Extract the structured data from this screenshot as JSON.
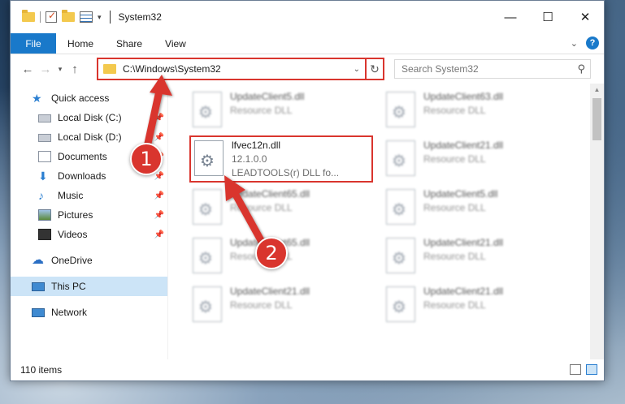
{
  "window": {
    "title": "System32"
  },
  "ribbon": {
    "tabs": [
      "File",
      "Home",
      "Share",
      "View"
    ]
  },
  "address": {
    "path": "C:\\Windows\\System32"
  },
  "search": {
    "placeholder": "Search System32"
  },
  "sidebar": {
    "items": [
      {
        "label": "Quick access",
        "icon": "star-icon",
        "pinned": false
      },
      {
        "label": "Local Disk (C:)",
        "icon": "drive-icon",
        "pinned": true
      },
      {
        "label": "Local Disk (D:)",
        "icon": "drive-icon",
        "pinned": true
      },
      {
        "label": "Documents",
        "icon": "documents-icon",
        "pinned": true
      },
      {
        "label": "Downloads",
        "icon": "download-icon",
        "pinned": true
      },
      {
        "label": "Music",
        "icon": "music-icon",
        "pinned": true
      },
      {
        "label": "Pictures",
        "icon": "pictures-icon",
        "pinned": true
      },
      {
        "label": "Videos",
        "icon": "videos-icon",
        "pinned": true
      },
      {
        "label": "OneDrive",
        "icon": "cloud-icon"
      },
      {
        "label": "This PC",
        "icon": "pc-icon",
        "selected": true
      },
      {
        "label": "Network",
        "icon": "network-icon"
      }
    ]
  },
  "files": {
    "left": [
      {
        "name": "UpdateClient5.dll",
        "type": "Resource DLL"
      },
      {
        "name": "lfvec12n.dll",
        "version": "12.1.0.0",
        "desc": "LEADTOOLS(r) DLL fo..."
      },
      {
        "name": "UpdateClient65.dll",
        "type": "Resource DLL"
      },
      {
        "name": "UpdateClient65.dll",
        "type": "Resource DLL"
      },
      {
        "name": "UpdateClient21.dll",
        "type": "Resource DLL"
      }
    ],
    "right": [
      {
        "name": "UpdateClient63.dll",
        "type": "Resource DLL"
      },
      {
        "name": "UpdateClient21.dll",
        "type": "Resource DLL"
      },
      {
        "name": "UpdateClient5.dll",
        "type": "Resource DLL"
      },
      {
        "name": "UpdateClient21.dll",
        "type": "Resource DLL"
      },
      {
        "name": "UpdateClient21.dll",
        "type": "Resource DLL"
      }
    ]
  },
  "status": {
    "count": "110 items"
  },
  "annotations": {
    "step1": "1",
    "step2": "2",
    "color": "#d9352e"
  }
}
